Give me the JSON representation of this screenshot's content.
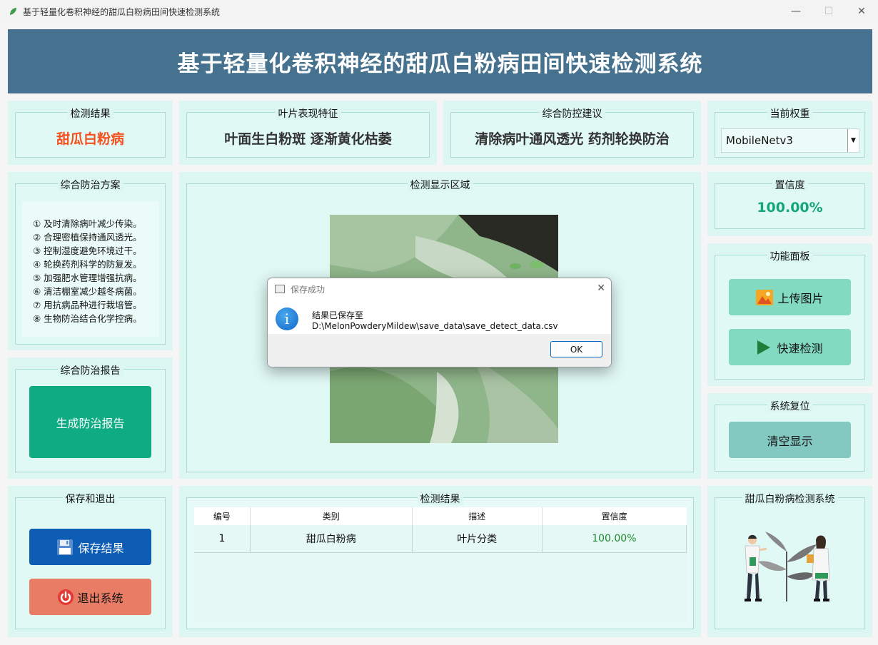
{
  "window": {
    "title": "基于轻量化卷积神经的甜瓜白粉病田间快速检测系统",
    "minimize": "—",
    "maximize": "☐",
    "close": "✕"
  },
  "banner": {
    "title": "基于轻量化卷积神经的甜瓜白粉病田间快速检测系统"
  },
  "detect_result": {
    "label": "检测结果",
    "value": "甜瓜白粉病",
    "color": "#f4511e"
  },
  "leaf_features": {
    "label": "叶片表现特征",
    "value": "叶面生白粉斑 逐渐黄化枯萎"
  },
  "control_advice": {
    "label": "综合防控建议",
    "value": "清除病叶通风透光 药剂轮换防治"
  },
  "weights": {
    "label": "当前权重",
    "selected": "MobileNetv3"
  },
  "plan": {
    "label": "综合防治方案",
    "items": [
      "① 及时清除病叶减少传染。",
      "② 合理密植保持通风透光。",
      "③ 控制湿度避免环境过干。",
      "④ 轮换药剂科学的防复发。",
      "⑤ 加强肥水管理增强抗病。",
      "⑥ 清洁棚室减少越冬病菌。",
      "⑦ 用抗病品种进行栽培管。",
      "⑧ 生物防治结合化学控病。"
    ]
  },
  "report": {
    "label": "综合防治报告",
    "button": "生成防治报告"
  },
  "save_exit": {
    "label": "保存和退出",
    "save_button": "保存结果",
    "exit_button": "退出系统"
  },
  "display": {
    "label": "检测显示区域"
  },
  "confidence": {
    "label": "置信度",
    "value": "100.00%",
    "color": "#17a67a"
  },
  "functions": {
    "label": "功能面板",
    "upload_button": "上传图片",
    "detect_button": "快速检测"
  },
  "reset": {
    "label": "系统复位",
    "clear_button": "清空显示"
  },
  "system_card": {
    "label": "甜瓜白粉病检测系统"
  },
  "results_table": {
    "label": "检测结果",
    "headers": [
      "编号",
      "类别",
      "描述",
      "置信度"
    ],
    "rows": [
      [
        "1",
        "甜瓜白粉病",
        "叶片分类",
        "100.00%"
      ]
    ]
  },
  "dialog": {
    "title": "保存成功",
    "message": "结果已保存至 D:\\MelonPowderyMildew\\save_data\\save_detect_data.csv",
    "ok": "OK"
  }
}
